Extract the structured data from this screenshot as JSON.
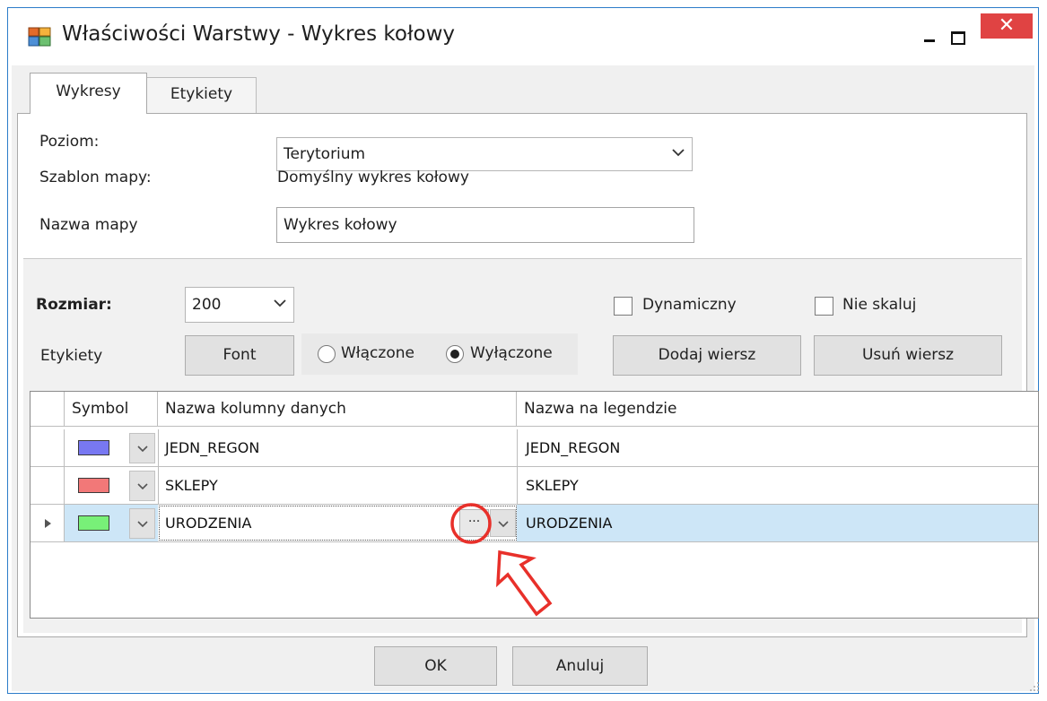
{
  "window": {
    "title": "Właściwości Warstwy - Wykres kołowy",
    "close_glyph": "✕"
  },
  "tabs": [
    {
      "label": "Wykresy",
      "active": true
    },
    {
      "label": "Etykiety",
      "active": false
    }
  ],
  "form": {
    "poziom_label": "Poziom:",
    "poziom_value": "Terytorium",
    "szablon_label": "Szablon mapy:",
    "szablon_value": "Domyślny wykres kołowy",
    "nazwa_label": "Nazwa mapy",
    "nazwa_value": "Wykres kołowy"
  },
  "options": {
    "rozmiar_label": "Rozmiar:",
    "rozmiar_value": "200",
    "dynamiczny_label": "Dynamiczny",
    "dynamiczny_checked": false,
    "nie_skaluj_label": "Nie skaluj",
    "nie_skaluj_checked": false,
    "etykiety_label": "Etykiety",
    "font_button": "Font",
    "wlaczone_label": "Włączone",
    "wylaczone_label": "Wyłączone",
    "selected_radio": "Wyłączone",
    "dodaj_button": "Dodaj wiersz",
    "usun_button": "Usuń wiersz"
  },
  "grid": {
    "columns": [
      "Symbol",
      "Nazwa kolumny danych",
      "Nazwa na legendzie"
    ],
    "rows": [
      {
        "color": "#7878f2",
        "column": "JEDN_REGON",
        "legend": "JEDN_REGON"
      },
      {
        "color": "#f27878",
        "column": "SKLEPY",
        "legend": "SKLEPY"
      },
      {
        "color": "#78f078",
        "column": "URODZENIA",
        "legend": "URODZENIA",
        "selected": true
      }
    ],
    "ellipsis_glyph": "···"
  },
  "footer": {
    "ok_button": "OK",
    "cancel_button": "Anuluj"
  },
  "colors": {
    "close_red": "#e04343",
    "selection": "#cde6f7",
    "annotation_red": "#e8302a"
  }
}
